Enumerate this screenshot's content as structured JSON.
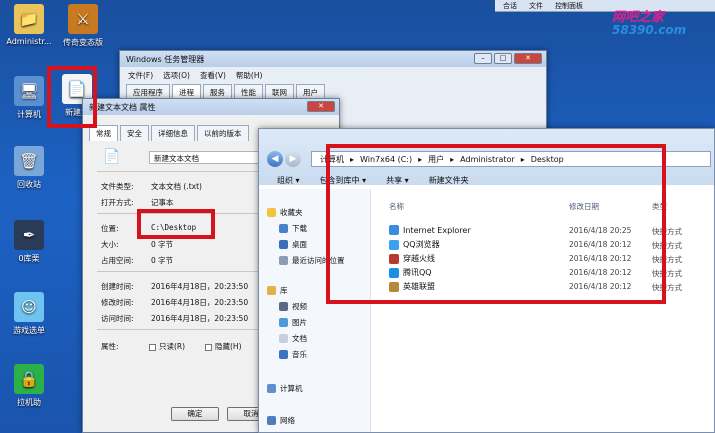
{
  "desktop": {
    "icons": [
      {
        "label": "Administr...",
        "icon": "user-folder-icon"
      },
      {
        "label": "传奇变态版",
        "icon": "game-icon"
      },
      {
        "label": "计算机",
        "icon": "computer-icon"
      },
      {
        "label": "新建文",
        "icon": "text-file-icon"
      },
      {
        "label": "回收站",
        "icon": "recycle-bin-icon"
      },
      {
        "label": "0库栗",
        "icon": "app-icon"
      },
      {
        "label": "游戏选单",
        "icon": "game-menu-icon"
      },
      {
        "label": "拉机助",
        "icon": "lock-icon"
      }
    ]
  },
  "topbar": {
    "item1": "合话",
    "item2": "文件",
    "item3": "控制面板"
  },
  "watermark": {
    "line1": "网吧之家",
    "line2": "58390.com"
  },
  "taskmgr": {
    "title": "Windows 任务管理器",
    "menu": [
      "文件(F)",
      "选项(O)",
      "查看(V)",
      "帮助(H)"
    ],
    "tabs": [
      "应用程序",
      "进程",
      "服务",
      "性能",
      "联网",
      "用户"
    ]
  },
  "props": {
    "title": "新建文本文档 属性",
    "tabs": [
      "常规",
      "安全",
      "详细信息",
      "以前的版本"
    ],
    "filename": "新建文本文档",
    "type_label": "文件类型:",
    "type_value": "文本文档 (.txt)",
    "open_label": "打开方式:",
    "open_value": "记事本",
    "location_label": "位置:",
    "location_value": "C:\\Desktop",
    "size_label": "大小:",
    "size_value": "0 字节",
    "disk_label": "占用空间:",
    "disk_value": "0 字节",
    "created_label": "创建时间:",
    "created_value": "2016年4月18日，20:23:50",
    "modified_label": "修改时间:",
    "modified_value": "2016年4月18日，20:23:50",
    "accessed_label": "访问时间:",
    "accessed_value": "2016年4月18日，20:23:50",
    "attr_label": "属性:",
    "readonly_label": "只读(R)",
    "hidden_label": "隐藏(H)",
    "ok_label": "确定",
    "cancel_label": "取消"
  },
  "explorer": {
    "breadcrumb": [
      "计算机",
      "Win7x64 (C:)",
      "用户",
      "Administrator",
      "Desktop"
    ],
    "toolbar": [
      "组织 ▾",
      "包含到库中 ▾",
      "共享 ▾",
      "新建文件夹"
    ],
    "nav": {
      "favorites": "收藏夹",
      "downloads": "下载",
      "desktop": "桌面",
      "recent": "最近访问的位置",
      "libraries": "库",
      "videos": "视频",
      "pictures": "图片",
      "documents": "文档",
      "music": "音乐",
      "computer": "计算机",
      "network": "网络"
    },
    "columns": {
      "name": "名称",
      "date": "修改日期",
      "type": "类型"
    },
    "files": [
      {
        "name": "Internet Explorer",
        "date": "2016/4/18 20:25",
        "type": "快捷方式"
      },
      {
        "name": "QQ浏览器",
        "date": "2016/4/18 20:12",
        "type": "快捷方式"
      },
      {
        "name": "穿越火线",
        "date": "2016/4/18 20:12",
        "type": "快捷方式"
      },
      {
        "name": "腾讯QQ",
        "date": "2016/4/18 20:12",
        "type": "快捷方式"
      },
      {
        "name": "英雄联盟",
        "date": "2016/4/18 20:12",
        "type": "快捷方式"
      }
    ]
  },
  "colors": {
    "highlight_box": "#d7121d",
    "desktop_bg": "#1c62c4"
  }
}
